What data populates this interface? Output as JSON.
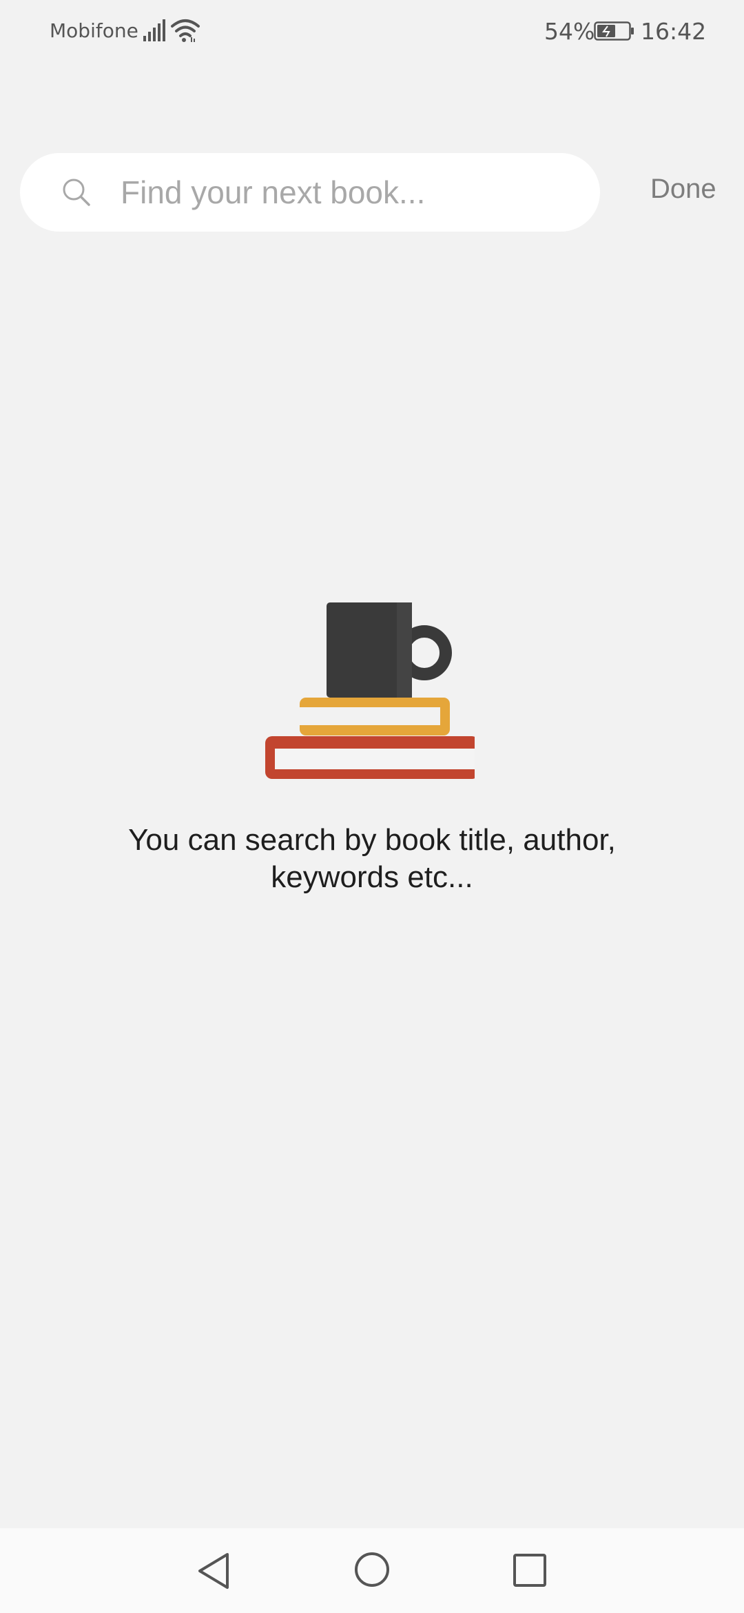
{
  "status_bar": {
    "carrier": "Mobifone",
    "battery_percent": "54%",
    "time": "16:42",
    "icons": [
      "signal-icon",
      "wifi-icon",
      "battery-charging-icon"
    ]
  },
  "search": {
    "placeholder": "Find your next book...",
    "value": "",
    "icon": "search-icon",
    "done_label": "Done"
  },
  "empty_state": {
    "illustration": "mug-on-books-icon",
    "message": "You can search by book title, author, keywords etc..."
  },
  "nav_bar": {
    "icons": [
      "back-icon",
      "home-icon",
      "recents-icon"
    ]
  },
  "colors": {
    "background": "#f2f2f2",
    "search_bg": "#ffffff",
    "placeholder": "#a8a8a8",
    "done_text": "#7d7d7d",
    "mug": "#3a3a3a",
    "book_top": "#e5a63a",
    "book_bottom": "#c2452f"
  }
}
